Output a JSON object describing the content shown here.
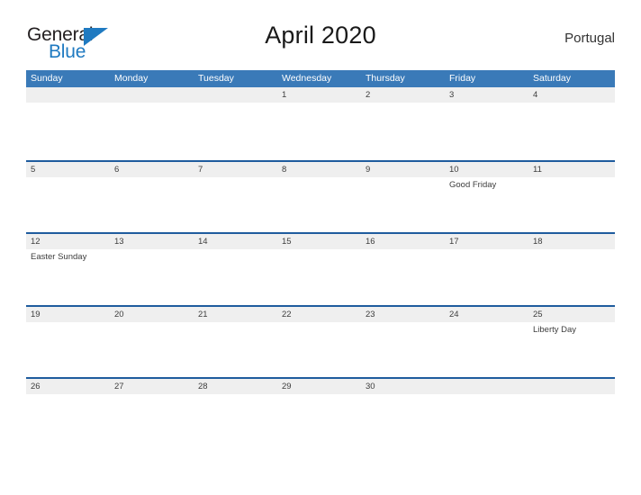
{
  "brand": {
    "name_part1": "General",
    "name_part2": "Blue",
    "triangle_color": "#1f7ac1",
    "text_color": "#231f20"
  },
  "header": {
    "title": "April 2020",
    "country": "Portugal"
  },
  "theme": {
    "header_blue": "#3a7ab8",
    "row_line_blue": "#1f5c9e",
    "date_band_gray": "#efefef",
    "text_color": "#3d3d3d"
  },
  "weekdays": [
    {
      "label": "Sunday"
    },
    {
      "label": "Monday"
    },
    {
      "label": "Tuesday"
    },
    {
      "label": "Wednesday"
    },
    {
      "label": "Thursday"
    },
    {
      "label": "Friday"
    },
    {
      "label": "Saturday"
    }
  ],
  "weeks": [
    {
      "days": [
        {
          "num": "",
          "events": []
        },
        {
          "num": "",
          "events": []
        },
        {
          "num": "",
          "events": []
        },
        {
          "num": "1",
          "events": []
        },
        {
          "num": "2",
          "events": []
        },
        {
          "num": "3",
          "events": []
        },
        {
          "num": "4",
          "events": []
        }
      ]
    },
    {
      "days": [
        {
          "num": "5",
          "events": []
        },
        {
          "num": "6",
          "events": []
        },
        {
          "num": "7",
          "events": []
        },
        {
          "num": "8",
          "events": []
        },
        {
          "num": "9",
          "events": []
        },
        {
          "num": "10",
          "events": [
            "Good Friday"
          ]
        },
        {
          "num": "11",
          "events": []
        }
      ]
    },
    {
      "days": [
        {
          "num": "12",
          "events": [
            "Easter Sunday"
          ]
        },
        {
          "num": "13",
          "events": []
        },
        {
          "num": "14",
          "events": []
        },
        {
          "num": "15",
          "events": []
        },
        {
          "num": "16",
          "events": []
        },
        {
          "num": "17",
          "events": []
        },
        {
          "num": "18",
          "events": []
        }
      ]
    },
    {
      "days": [
        {
          "num": "19",
          "events": []
        },
        {
          "num": "20",
          "events": []
        },
        {
          "num": "21",
          "events": []
        },
        {
          "num": "22",
          "events": []
        },
        {
          "num": "23",
          "events": []
        },
        {
          "num": "24",
          "events": []
        },
        {
          "num": "25",
          "events": [
            "Liberty Day"
          ]
        }
      ]
    },
    {
      "days": [
        {
          "num": "26",
          "events": []
        },
        {
          "num": "27",
          "events": []
        },
        {
          "num": "28",
          "events": []
        },
        {
          "num": "29",
          "events": []
        },
        {
          "num": "30",
          "events": []
        },
        {
          "num": "",
          "events": []
        },
        {
          "num": "",
          "events": []
        }
      ]
    }
  ]
}
